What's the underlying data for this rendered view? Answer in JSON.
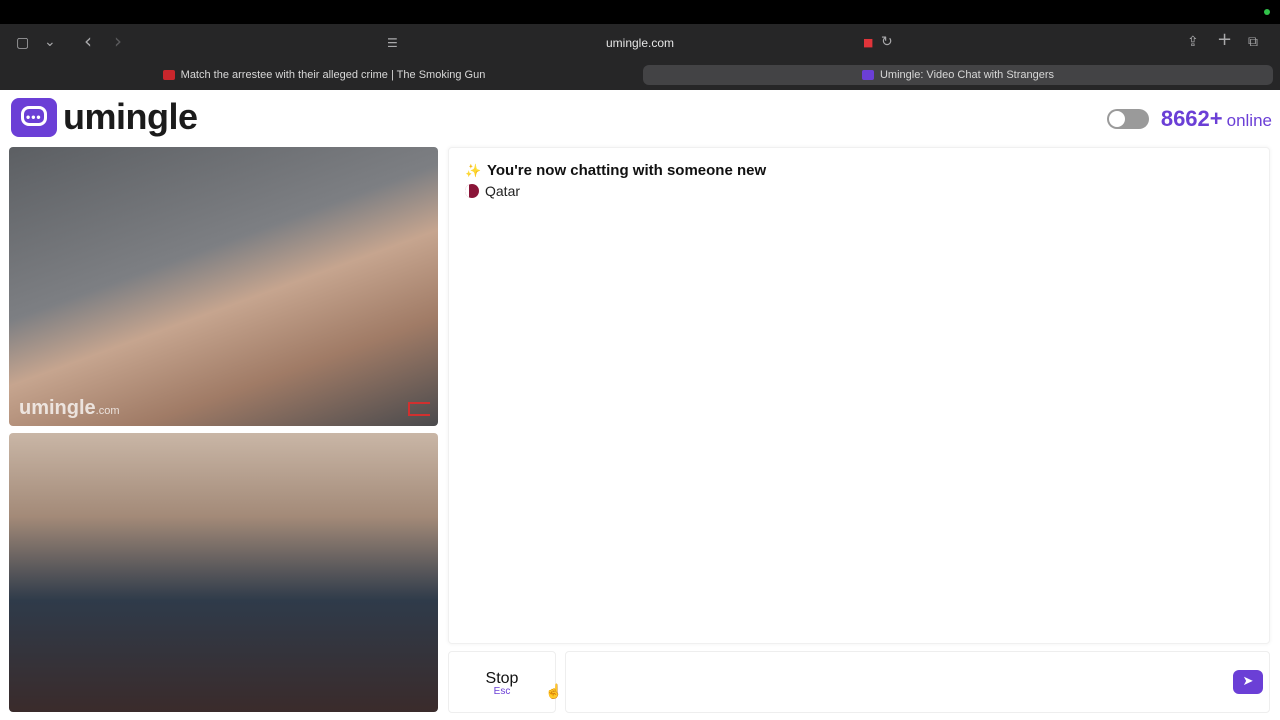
{
  "browser": {
    "url": "umingle.com",
    "tabs": [
      {
        "title": "Match the arrestee with their alleged crime | The Smoking Gun",
        "active": false
      },
      {
        "title": "Umingle: Video Chat with Strangers",
        "active": true
      }
    ],
    "icons": {
      "sidebar": "▢",
      "chevron": "⌄",
      "back": "‹",
      "forward": "›",
      "reader": "☰",
      "camera": "■",
      "reload": "↻",
      "share": "⇪",
      "new_tab": "+",
      "tabs_overview": "⧉"
    }
  },
  "header": {
    "logo_text": "umingle",
    "online_count": "8662+",
    "online_label": "online"
  },
  "video": {
    "watermark_main": "umingle",
    "watermark_suffix": ".com"
  },
  "chat": {
    "sparkle": "✨",
    "intro": "You're now chatting with someone new",
    "country": "Qatar"
  },
  "controls": {
    "stop_label": "Stop",
    "stop_key": "Esc",
    "message_placeholder": "",
    "send_icon": "➤"
  },
  "colors": {
    "brand": "#6b3fd6",
    "chrome_bg": "#262627",
    "qatar_maroon": "#8a1538"
  }
}
